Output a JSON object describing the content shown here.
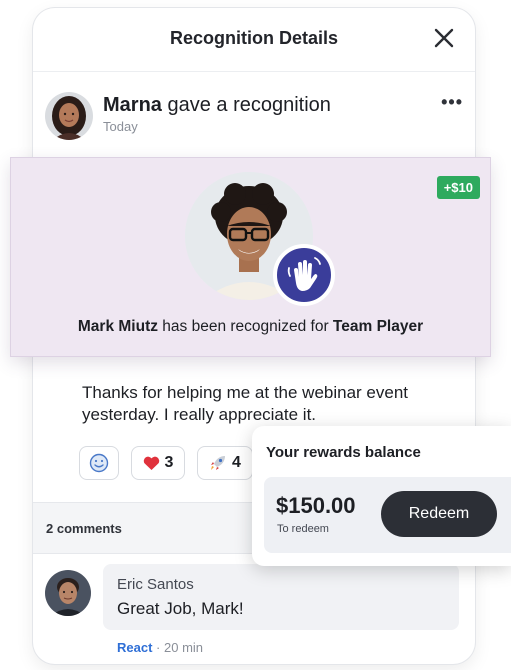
{
  "header": {
    "title": "Recognition Details",
    "close_icon": "close-icon"
  },
  "post": {
    "giver": "Marna",
    "action": "gave a recognition",
    "time": "Today",
    "more_icon": "more-horizontal-icon",
    "more_glyph": "•••"
  },
  "recognition": {
    "points": "+$10",
    "recipient": "Mark Miutz",
    "phrase": "has been recognized for",
    "value": "Team Player",
    "badge_icon": "waving-hand-icon",
    "badge_color": "#3a3d9a",
    "panel_color": "#efe7f2",
    "points_color": "#2eaa5e"
  },
  "message": "Thanks for helping me at the webinar event yesterday. I really appreciate it.",
  "reactions": [
    {
      "icon": "smiley-icon",
      "count": ""
    },
    {
      "icon": "heart-icon",
      "count": "3"
    },
    {
      "icon": "rocket-icon",
      "count": "4"
    }
  ],
  "comments": {
    "count_label": "2 comments",
    "items": [
      {
        "author": "Eric Santos",
        "text": "Great Job, Mark!",
        "react_label": "React",
        "separator": "·",
        "time": "20 min"
      }
    ]
  },
  "rewards": {
    "title": "Your rewards balance",
    "amount": "$150.00",
    "amount_sub": "To redeem",
    "redeem_label": "Redeem",
    "button_color": "#2c2f36"
  }
}
